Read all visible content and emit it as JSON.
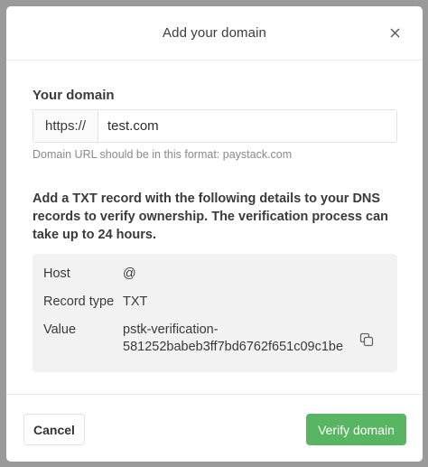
{
  "modal": {
    "title": "Add your domain",
    "close_icon": "close-icon"
  },
  "domain_field": {
    "label": "Your domain",
    "prefix": "https://",
    "value": "test.com",
    "hint": "Domain URL should be in this format: paystack.com"
  },
  "instructions": "Add a TXT record with the following details to your DNS records to verify ownership. The verification process can take up to 24 hours.",
  "record": {
    "rows": [
      {
        "key": "Host",
        "value": "@"
      },
      {
        "key": "Record type",
        "value": "TXT"
      },
      {
        "key": "Value",
        "value_line1": "pstk-verification-",
        "value_line2": "581252babeb3ff7bd6762f651c09c1be"
      }
    ],
    "copy_icon": "copy-icon"
  },
  "footer": {
    "cancel_label": "Cancel",
    "verify_label": "Verify domain"
  },
  "colors": {
    "primary_green": "#58b663",
    "record_bg": "#f2f2f2",
    "backdrop": "#9a9a9a"
  }
}
